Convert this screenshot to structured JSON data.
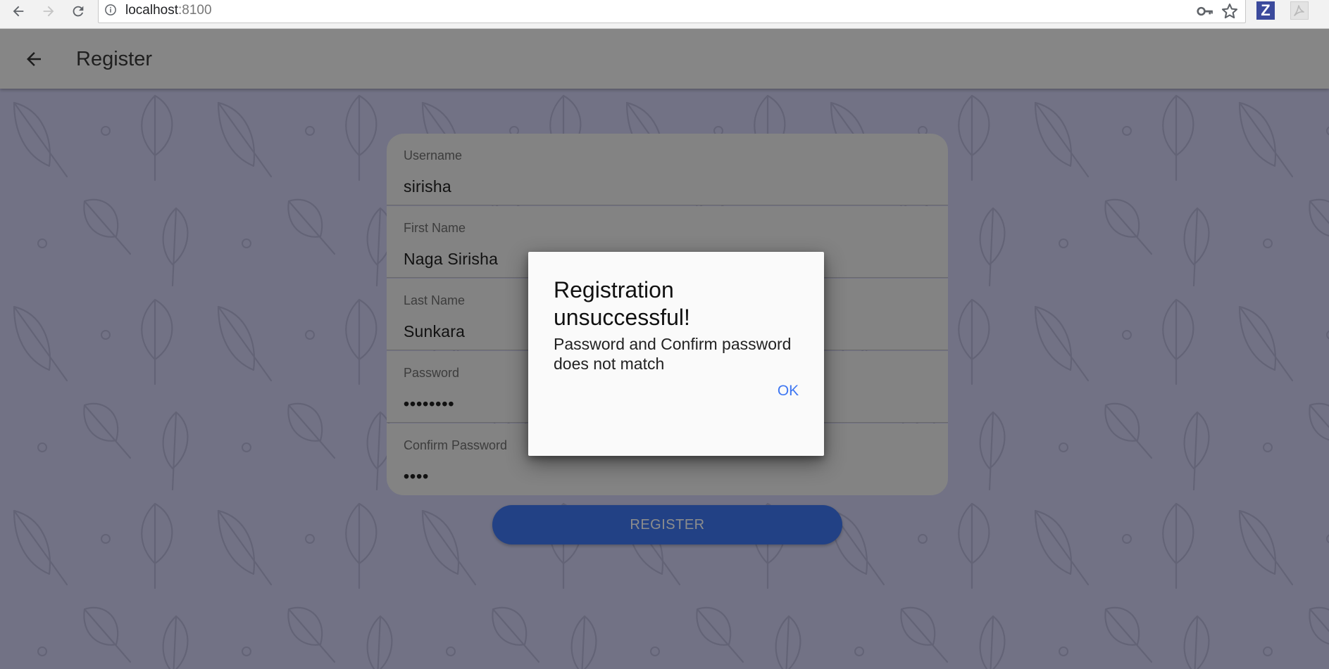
{
  "browser": {
    "url_host": "localhost",
    "url_port": ":8100",
    "extension_z_label": "Z"
  },
  "toolbar": {
    "title": "Register"
  },
  "form": {
    "fields": [
      {
        "label": "Username",
        "value": "sirisha"
      },
      {
        "label": "First Name",
        "value": "Naga Sirisha"
      },
      {
        "label": "Last Name",
        "value": "Sunkara"
      },
      {
        "label": "Password",
        "value": "••••••••"
      },
      {
        "label": "Confirm Password",
        "value": "••••"
      }
    ],
    "submit_label": "REGISTER"
  },
  "dialog": {
    "title": "Registration unsuccessful!",
    "message": "Password and Confirm password does not match",
    "ok_label": "OK"
  },
  "colors": {
    "accent": "#3f77f2",
    "background": "#cfd0f2",
    "toolbar": "#f5f5f5",
    "field": "#eeeeee"
  },
  "icons": {
    "browser_back": "arrow-left-icon",
    "browser_forward": "arrow-right-icon",
    "reload": "reload-icon",
    "site_info": "info-icon",
    "password_key": "key-icon",
    "bookmark": "star-icon",
    "app_back": "arrow-left-icon",
    "background_pattern": "leaf-icon"
  }
}
